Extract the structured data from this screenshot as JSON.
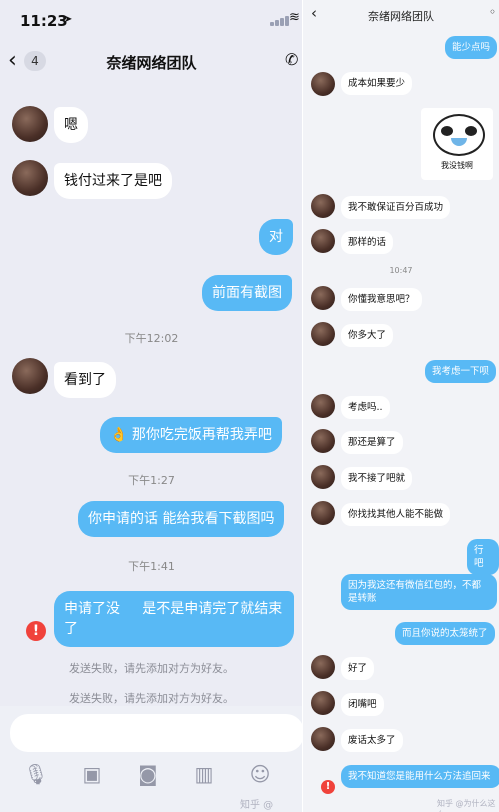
{
  "left": {
    "status": {
      "time": "11:23",
      "location_icon": "location-arrow-icon"
    },
    "header": {
      "unread_count": "4",
      "title": "奈绪网络团队"
    },
    "messages": [
      {
        "side": "in",
        "text": "嗯"
      },
      {
        "side": "in",
        "text": "钱付过来了是吧"
      },
      {
        "side": "out",
        "text": "对"
      },
      {
        "side": "out",
        "text": "前面有截图"
      },
      {
        "side": "time",
        "text": "下午12:02"
      },
      {
        "side": "in",
        "text": "看到了"
      },
      {
        "side": "out",
        "text": "👌 那你吃完饭再帮我弄吧"
      },
      {
        "side": "time",
        "text": "下午1:27"
      },
      {
        "side": "out",
        "text": "你申请的话 能给我看下截图吗"
      },
      {
        "side": "time",
        "text": "下午1:41"
      },
      {
        "side": "out",
        "text": "申请了没     是不是申请完了就结束了",
        "failed": true
      },
      {
        "side": "note",
        "text": "发送失败，请先添加对方为好友。"
      },
      {
        "side": "note",
        "text": "发送失败，请先添加对方为好友。"
      }
    ],
    "watermark": "知乎 @"
  },
  "right": {
    "header": {
      "title": "奈绪网络团队"
    },
    "messages": [
      {
        "side": "out",
        "text": "能少点吗"
      },
      {
        "side": "in",
        "text": "成本如果要少"
      },
      {
        "side": "sticker",
        "text": "我没钱啊"
      },
      {
        "side": "in",
        "text": "我不敢保证百分百成功"
      },
      {
        "side": "in",
        "text": "那样的话"
      },
      {
        "side": "time",
        "text": "10:47"
      },
      {
        "side": "in",
        "text": "你懂我意思吧？"
      },
      {
        "side": "in",
        "text": "你多大了"
      },
      {
        "side": "out",
        "text": "我考虑一下呗"
      },
      {
        "side": "in",
        "text": "考虑吗.."
      },
      {
        "side": "in",
        "text": "那还是算了"
      },
      {
        "side": "in",
        "text": "我不接了吧就"
      },
      {
        "side": "in",
        "text": "你找找其他人能不能做"
      },
      {
        "side": "out",
        "text": "行吧"
      },
      {
        "side": "out",
        "text": "因为我这还有微信红包的，不都是转账"
      },
      {
        "side": "out",
        "text": "而且你说的太笼统了"
      },
      {
        "side": "in",
        "text": "好了"
      },
      {
        "side": "in",
        "text": "闭嘴吧"
      },
      {
        "side": "in",
        "text": "废话太多了"
      },
      {
        "side": "out",
        "text": "我不知道您是能用什么方法追回来",
        "failed": true
      }
    ],
    "watermark": "知乎 @为什么这么"
  }
}
